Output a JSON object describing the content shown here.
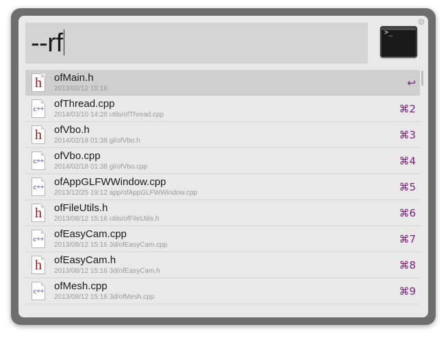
{
  "search": {
    "query": "--rf"
  },
  "settings_icon": "gear-icon",
  "terminal": {
    "prompt": ">_"
  },
  "results": [
    {
      "title": "ofMain.h",
      "subtitle": "2013/08/12 15:16",
      "shortcut": "↩",
      "type": "h"
    },
    {
      "title": "ofThread.cpp",
      "subtitle": "2014/03/10 14:28 utils/ofThread.cpp",
      "shortcut": "⌘2",
      "type": "cpp"
    },
    {
      "title": "ofVbo.h",
      "subtitle": "2014/02/18 01:38 gl/ofVbo.h",
      "shortcut": "⌘3",
      "type": "h"
    },
    {
      "title": "ofVbo.cpp",
      "subtitle": "2014/02/18 01:38 gl/ofVbo.cpp",
      "shortcut": "⌘4",
      "type": "cpp"
    },
    {
      "title": "ofAppGLFWWindow.cpp",
      "subtitle": "2013/12/25 19:12 app/ofAppGLFWWindow.cpp",
      "shortcut": "⌘5",
      "type": "cpp"
    },
    {
      "title": "ofFileUtils.h",
      "subtitle": "2013/08/12 15:16 utils/ofFileUtils.h",
      "shortcut": "⌘6",
      "type": "h"
    },
    {
      "title": "ofEasyCam.cpp",
      "subtitle": "2013/08/12 15:16 3d/ofEasyCam.cpp",
      "shortcut": "⌘7",
      "type": "cpp"
    },
    {
      "title": "ofEasyCam.h",
      "subtitle": "2013/08/12 15:16 3d/ofEasyCam.h",
      "shortcut": "⌘8",
      "type": "h"
    },
    {
      "title": "ofMesh.cpp",
      "subtitle": "2013/08/12 15:16 3d/ofMesh.cpp",
      "shortcut": "⌘9",
      "type": "cpp"
    }
  ],
  "icon_glyphs": {
    "h": "h",
    "cpp": "c++"
  },
  "colors": {
    "selected_row": "#cfcfcf",
    "shortcut": "#7a1f7a",
    "header_glyph": "#8b1a1a",
    "cpp_glyph": "#3c2f8f"
  }
}
